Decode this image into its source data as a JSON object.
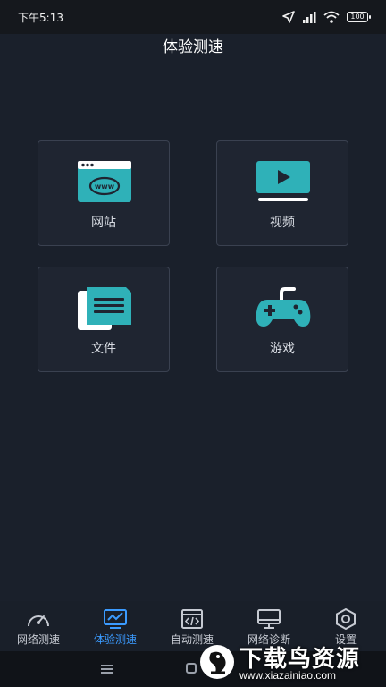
{
  "status_bar": {
    "time": "下午5:13",
    "battery": "100"
  },
  "page_title": "体验测速",
  "tiles": [
    {
      "label": "网站",
      "icon": "website-www-icon"
    },
    {
      "label": "视频",
      "icon": "video-play-icon"
    },
    {
      "label": "文件",
      "icon": "file-icon"
    },
    {
      "label": "游戏",
      "icon": "gamepad-icon"
    }
  ],
  "colors": {
    "accent_teal": "#2fb1b8",
    "active_blue": "#3b9bff"
  },
  "bottom_nav": {
    "items": [
      {
        "label": "网络测速",
        "icon": "speedometer-icon",
        "active": false
      },
      {
        "label": "体验测速",
        "icon": "chart-monitor-icon",
        "active": true
      },
      {
        "label": "自动测速",
        "icon": "code-window-icon",
        "active": false
      },
      {
        "label": "网络诊断",
        "icon": "monitor-icon",
        "active": false
      },
      {
        "label": "设置",
        "icon": "hexagon-settings-icon",
        "active": false
      }
    ]
  },
  "watermark": {
    "title": "下载鸟资源",
    "url": "www.xiazainiao.com"
  }
}
